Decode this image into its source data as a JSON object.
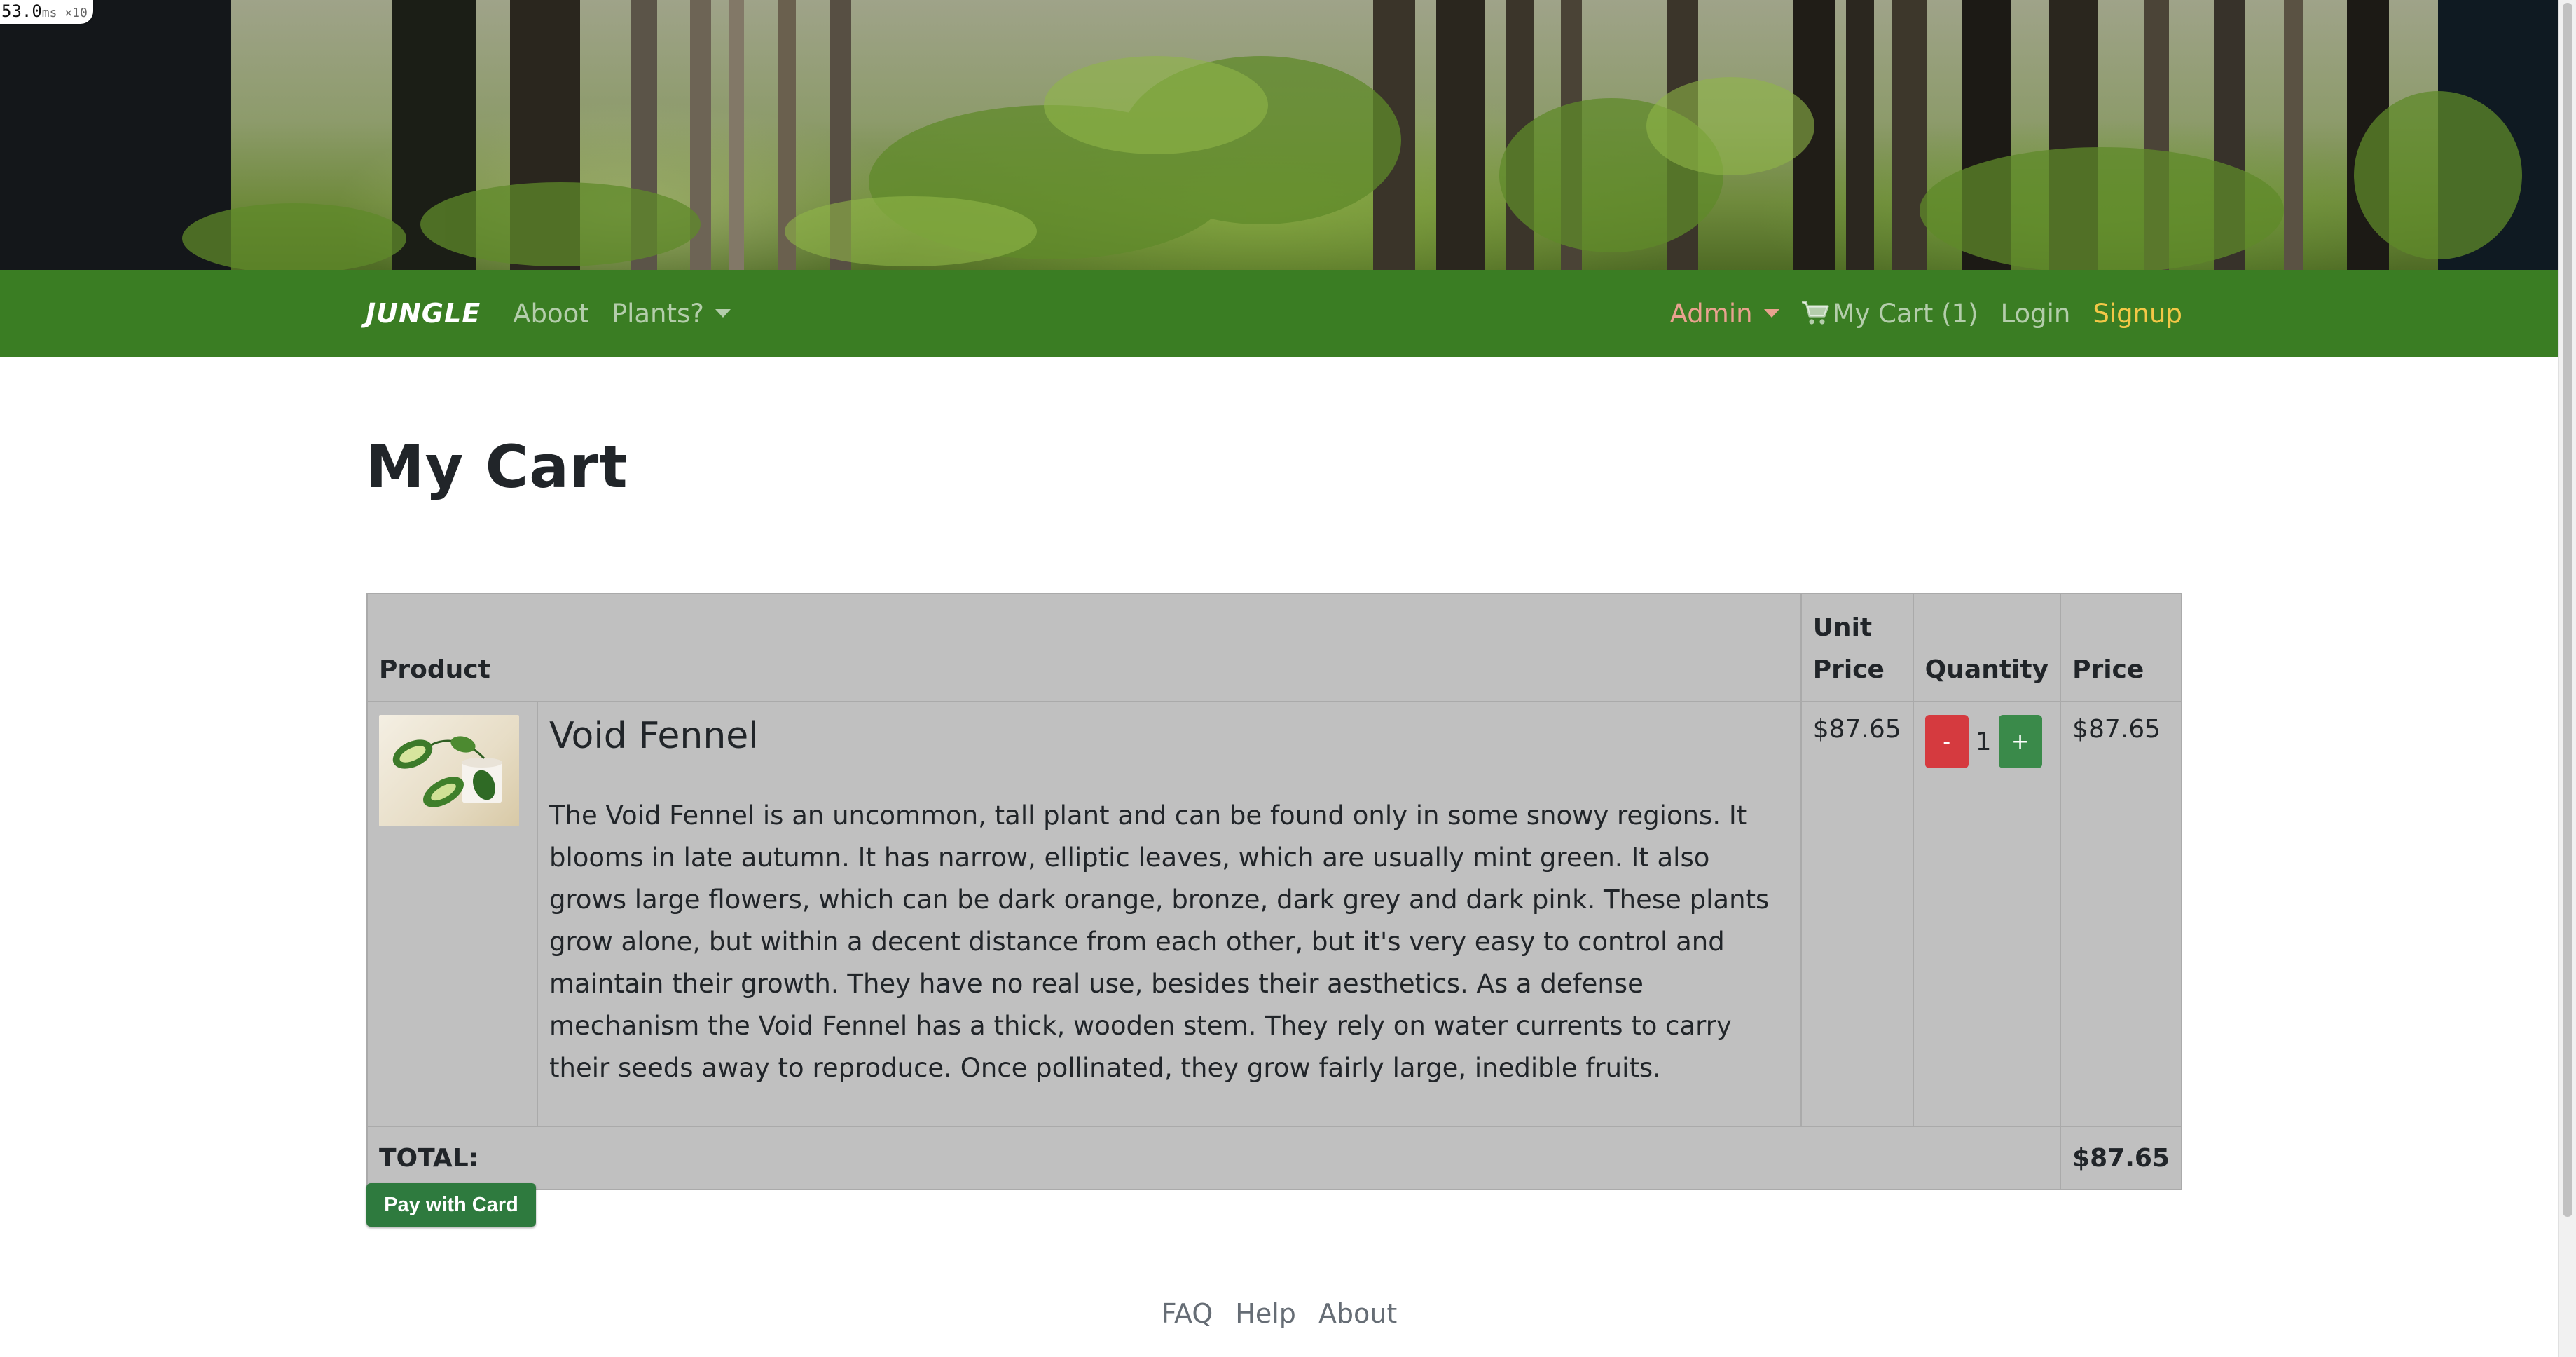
{
  "perf": {
    "value": "53.0",
    "unit": "ms ×10"
  },
  "navbar": {
    "brand": "JUNGLE",
    "about": "Aboot",
    "plants": "Plants?",
    "admin": "Admin",
    "cart_icon": "cart-icon",
    "cart": "My Cart (1)",
    "login": "Login",
    "signup": "Signup",
    "colors": {
      "background": "#3a7d23",
      "admin": "#e9a28f",
      "signup": "#f3c747"
    }
  },
  "page": {
    "title": "My Cart"
  },
  "cart_table": {
    "headers": {
      "product": "Product",
      "unit_price": "Unit Price",
      "quantity": "Quantity",
      "price": "Price"
    },
    "items": [
      {
        "name": "Void Fennel",
        "description": "The Void Fennel is an uncommon, tall plant and can be found only in some snowy regions. It blooms in late autumn. It has narrow, elliptic leaves, which are usually mint green. It also grows large flowers, which can be dark orange, bronze, dark grey and dark pink. These plants grow alone, but within a decent distance from each other, but it's very easy to control and maintain their growth. They have no real use, besides their aesthetics. As a defense mechanism the Void Fennel has a thick, wooden stem. They rely on water currents to carry their seeds away to reproduce. Once pollinated, they grow fairly large, inedible fruits.",
        "unit_price": "$87.65",
        "quantity": "1",
        "decrement_label": "-",
        "increment_label": "+",
        "price": "$87.65"
      }
    ],
    "total_label": "TOTAL:",
    "total_value": "$87.65"
  },
  "checkout": {
    "pay_label": "Pay with Card"
  },
  "footer": {
    "faq": "FAQ",
    "help": "Help",
    "about": "About"
  }
}
